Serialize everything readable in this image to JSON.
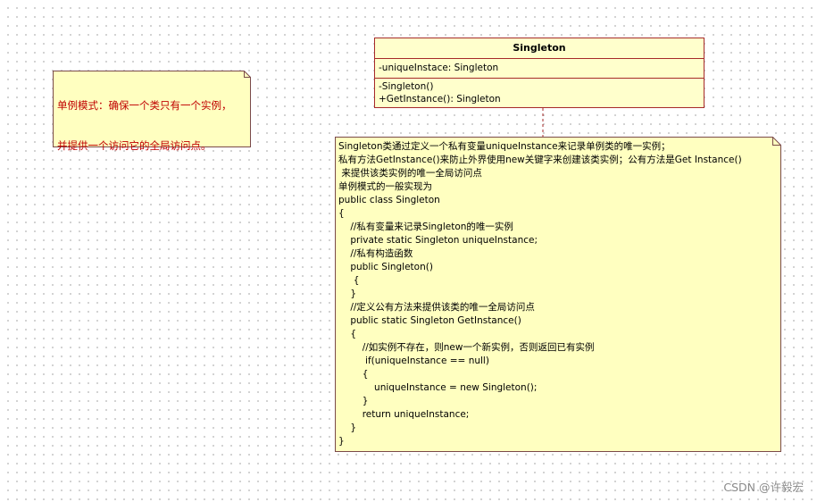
{
  "left_note": {
    "lines": [
      "单例模式：确保一个类只有一个实例，",
      "并提供一个访问它的全局访问点。"
    ]
  },
  "class_box": {
    "name": "Singleton",
    "attributes": [
      "-uniqueInstace: Singleton"
    ],
    "operations": [
      "-Singleton()",
      "+GetInstance(): Singleton"
    ]
  },
  "right_note": {
    "lines": [
      "Singleton类通过定义一个私有变量uniqueInstance来记录单例类的唯一实例；",
      "私有方法GetInstance()来防止外界使用new关键字来创建该类实例；公有方法是Get Instance()",
      " 来提供该类实例的唯一全局访问点",
      "单例模式的一般实现为",
      "public class Singleton",
      "{",
      "    //私有变量来记录Singleton的唯一实例",
      "    private static Singleton uniqueInstance;",
      "    //私有构造函数",
      "    public Singleton()",
      "     {",
      "    }",
      "    //定义公有方法来提供该类的唯一全局访问点",
      "    public static Singleton GetInstance()",
      "    {",
      "        //如实例不存在，则new一个新实例，否则返回已有实例",
      "         if(uniqueInstance == null)",
      "        {",
      "            uniqueInstance = new Singleton();",
      "        }",
      "        return uniqueInstance;",
      "    }",
      "}"
    ]
  },
  "watermark": "CSDN @许毅宏",
  "colors": {
    "note_fill": "#ffffc0",
    "note_border": "#7a4a4a",
    "class_fill": "#ffffcc",
    "class_border": "#a62a2a",
    "left_note_text": "#c00000",
    "connector": "#a62a2a"
  }
}
